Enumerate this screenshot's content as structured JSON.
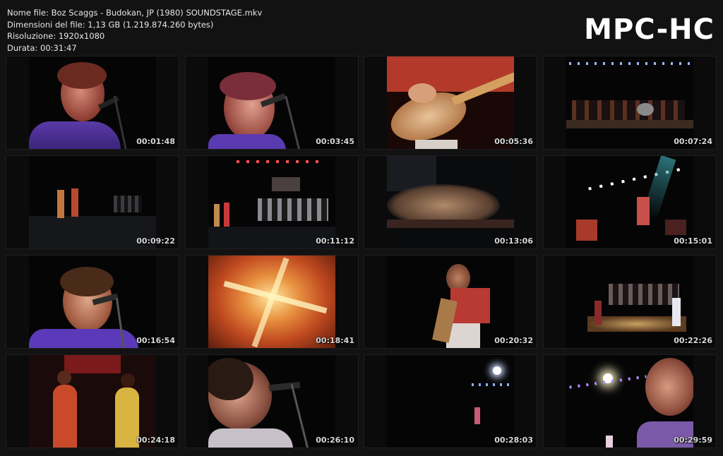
{
  "file_info": {
    "name": "Nome file: Boz Scaggs - Budokan, JP (1980) SOUNDSTAGE.mkv",
    "size": "Dimensioni del file: 1,13 GB (1.219.874.260 bytes)",
    "resolution": "Risoluzione: 1920x1080",
    "duration": "Durata: 00:31:47"
  },
  "logo": "MPC-HC",
  "thumbnails": [
    {
      "timestamp": "00:01:48",
      "scene": "singer-closeup-mic"
    },
    {
      "timestamp": "00:03:45",
      "scene": "singer-closeup-mic"
    },
    {
      "timestamp": "00:05:36",
      "scene": "guitar-closeup"
    },
    {
      "timestamp": "00:07:24",
      "scene": "stage-wide"
    },
    {
      "timestamp": "00:09:22",
      "scene": "stage-performers"
    },
    {
      "timestamp": "00:11:12",
      "scene": "stage-drums-lights"
    },
    {
      "timestamp": "00:13:06",
      "scene": "blurred-hand"
    },
    {
      "timestamp": "00:15:01",
      "scene": "stage-spotlights"
    },
    {
      "timestamp": "00:16:54",
      "scene": "singer-closeup-mic"
    },
    {
      "timestamp": "00:18:41",
      "scene": "light-flare"
    },
    {
      "timestamp": "00:20:32",
      "scene": "guitarist-standing"
    },
    {
      "timestamp": "00:22:26",
      "scene": "stage-band-wide"
    },
    {
      "timestamp": "00:24:18",
      "scene": "backing-singers"
    },
    {
      "timestamp": "00:26:10",
      "scene": "singer-profile-mic"
    },
    {
      "timestamp": "00:28:03",
      "scene": "dark-stage-light"
    },
    {
      "timestamp": "00:29:59",
      "scene": "singer-spotlight"
    }
  ],
  "colors": {
    "background": "#121212",
    "text": "#e6e6e6"
  }
}
